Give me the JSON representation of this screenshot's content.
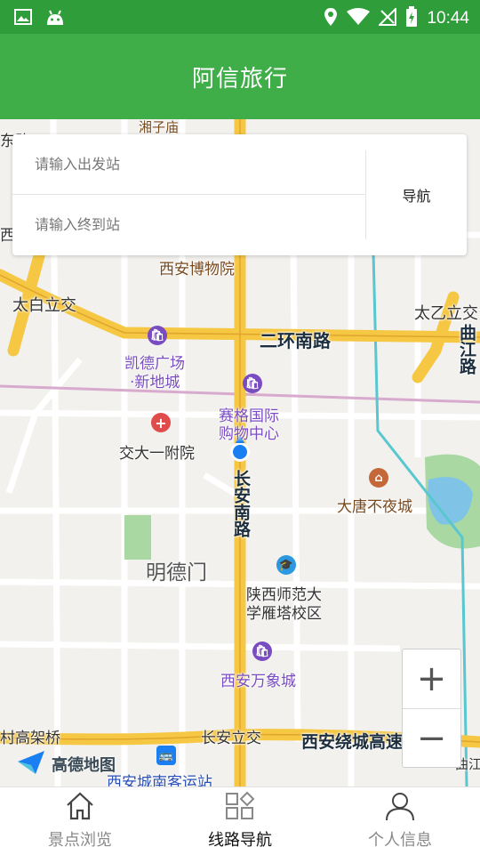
{
  "status_bar": {
    "time": "10:44",
    "icons_left": [
      "gallery-icon",
      "android-icon"
    ],
    "icons_right": [
      "location-icon",
      "wifi-icon",
      "no-signal-icon",
      "battery-charging-icon"
    ]
  },
  "app_bar": {
    "title": "阿信旅行"
  },
  "search": {
    "from_placeholder": "请输入出发站",
    "to_placeholder": "请输入终到站",
    "nav_label": "导航"
  },
  "map": {
    "labels": {
      "xian_museum": "西安博物院",
      "taibai_interchange": "太白立交",
      "taiyi_interchange": "太乙立交",
      "second_ring_south": "二环南路",
      "qujiang_road": "曲江路",
      "kaide_plaza": "凯德广场",
      "xindi_city": "·新地城",
      "saige_mall_1": "赛格国际",
      "saige_mall_2": "购物中心",
      "jiaoda_hospital": "交大一附院",
      "changan_south_road": "长安南路",
      "datang_night_city": "大唐不夜城",
      "mingde_gate": "明德门",
      "snnu_1": "陕西师范大",
      "snnu_2": "学雁塔校区",
      "mixc": "西安万象城",
      "changan_interchange": "长安立交",
      "ring_expressway": "西安绕城高速",
      "high_bridge": "村高架桥",
      "south_bus_station": "西安城南客运站",
      "top_partial": "湘子庙",
      "left_partial_top": "东路",
      "left_partial_mid": "西",
      "right_partial_bottom": "曲江"
    },
    "zoom_in": "+",
    "zoom_out": "−",
    "provider": "高德地图"
  },
  "bottom_nav": {
    "tabs": [
      {
        "label": "景点浏览",
        "icon": "home-icon",
        "active": false
      },
      {
        "label": "线路导航",
        "icon": "grid-icon",
        "active": true
      },
      {
        "label": "个人信息",
        "icon": "person-icon",
        "active": false
      }
    ]
  },
  "colors": {
    "status_bar": "#2f9e3a",
    "app_bar": "#3fae49",
    "road_major": "#f6c743",
    "poi_purple": "#7a4cc2",
    "poi_red": "#e04b4b",
    "poi_brown": "#c4683a",
    "location_blue": "#1a7ff0"
  }
}
